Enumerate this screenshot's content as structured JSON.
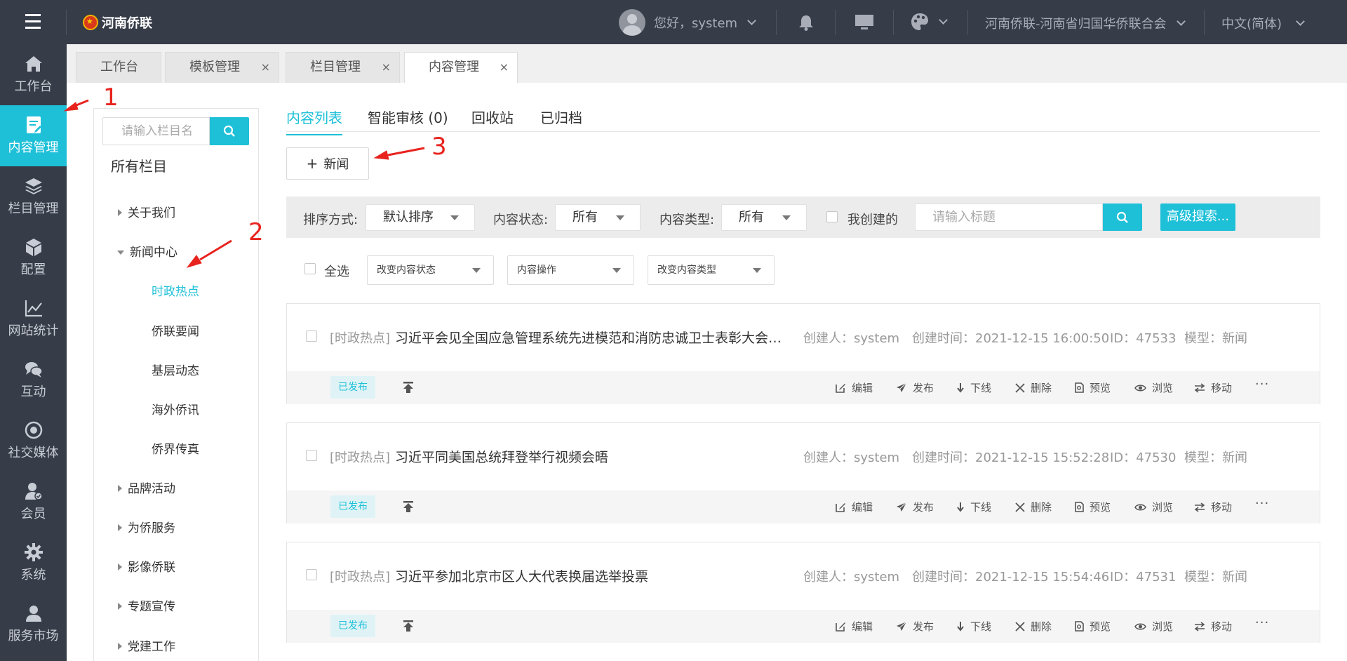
{
  "header": {
    "logo_text": "河南侨联",
    "greeting": "您好，system",
    "org_name": "河南侨联-河南省归国华侨联合会",
    "language": "中文(简体)"
  },
  "sidebar": {
    "items": [
      {
        "label": "工作台",
        "icon": "home-icon"
      },
      {
        "label": "内容管理",
        "icon": "document-edit-icon",
        "active": true
      },
      {
        "label": "栏目管理",
        "icon": "layers-icon"
      },
      {
        "label": "配置",
        "icon": "cube-icon"
      },
      {
        "label": "网站统计",
        "icon": "line-chart-icon"
      },
      {
        "label": "互动",
        "icon": "chat-icon"
      },
      {
        "label": "社交媒体",
        "icon": "target-icon"
      },
      {
        "label": "会员",
        "icon": "member-icon"
      },
      {
        "label": "系统",
        "icon": "gear-icon"
      },
      {
        "label": "服务市场",
        "icon": "service-icon"
      }
    ]
  },
  "tabs": [
    {
      "label": "工作台",
      "closable": false
    },
    {
      "label": "模板管理",
      "closable": true,
      "close": "×"
    },
    {
      "label": "栏目管理",
      "closable": true,
      "close": "×"
    },
    {
      "label": "内容管理",
      "closable": true,
      "close": "×",
      "active": true
    }
  ],
  "tree": {
    "search_placeholder": "请输入栏目名",
    "root": "所有栏目",
    "nodes": [
      {
        "label": "关于我们",
        "expanded": false
      },
      {
        "label": "新闻中心",
        "expanded": true
      },
      {
        "label": "时政热点",
        "child": true,
        "selected": true
      },
      {
        "label": "侨联要闻",
        "child": true
      },
      {
        "label": "基层动态",
        "child": true
      },
      {
        "label": "海外侨讯",
        "child": true
      },
      {
        "label": "侨界传真",
        "child": true
      },
      {
        "label": "品牌活动",
        "expanded": false
      },
      {
        "label": "为侨服务",
        "expanded": false
      },
      {
        "label": "影像侨联",
        "expanded": false
      },
      {
        "label": "专题宣传",
        "expanded": false
      },
      {
        "label": "党建工作",
        "expanded": false
      }
    ]
  },
  "subtabs": [
    {
      "label": "内容列表",
      "active": true
    },
    {
      "label": "智能审核 (0)"
    },
    {
      "label": "回收站"
    },
    {
      "label": "已归档"
    }
  ],
  "new_button": "新闻",
  "filters": {
    "sort_label": "排序方式:",
    "sort_value": "默认排序",
    "status_label": "内容状态:",
    "status_value": "所有",
    "type_label": "内容类型:",
    "type_value": "所有",
    "mine_label": "我创建的",
    "search_placeholder": "请输入标题",
    "advanced": "高级搜索..."
  },
  "bulk": {
    "select_all": "全选",
    "change_status": "改变内容状态",
    "operation": "内容操作",
    "change_type": "改变内容类型"
  },
  "items": [
    {
      "category": "[时政热点]",
      "title": "习近平会见全国应急管理系统先进模范和消防忠诚卫士表彰大会代表",
      "creator": "创建人：system",
      "created": "创建时间：2021-12-15 16:00:50",
      "id": "ID：47533",
      "model": "模型：新闻",
      "status": "已发布"
    },
    {
      "category": "[时政热点]",
      "title": "习近平同美国总统拜登举行视频会晤",
      "creator": "创建人：system",
      "created": "创建时间：2021-12-15 15:52:28",
      "id": "ID：47530",
      "model": "模型：新闻",
      "status": "已发布"
    },
    {
      "category": "[时政热点]",
      "title": "习近平参加北京市区人大代表换届选举投票",
      "creator": "创建人：system",
      "created": "创建时间：2021-12-15 15:54:46",
      "id": "ID：47531",
      "model": "模型：新闻",
      "status": "已发布"
    }
  ],
  "actions": {
    "edit": "编辑",
    "publish": "发布",
    "offline": "下线",
    "delete": "删除",
    "preview": "预览",
    "browse": "浏览",
    "move": "移动",
    "more": "···"
  },
  "annotations": [
    "1",
    "2",
    "3"
  ],
  "colors": {
    "accent": "#1ec0d8",
    "sidebar": "#363c48",
    "annotation": "#e8231e"
  }
}
